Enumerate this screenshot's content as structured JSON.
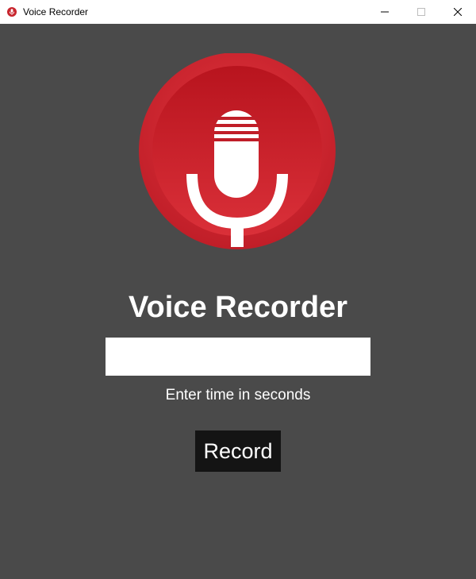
{
  "window": {
    "title": "Voice Recorder",
    "icon": "microphone-icon",
    "controls": [
      "minimize-icon",
      "maximize-icon",
      "close-icon"
    ]
  },
  "main": {
    "logo_icon": "microphone-logo-icon",
    "heading": "Voice Recorder",
    "time_input": {
      "value": "",
      "placeholder": ""
    },
    "hint": "Enter time in seconds",
    "record_button": "Record"
  },
  "colors": {
    "background": "#4a4a4a",
    "logo_red": "#d7323b",
    "button_bg": "#141414",
    "text": "#ffffff"
  }
}
